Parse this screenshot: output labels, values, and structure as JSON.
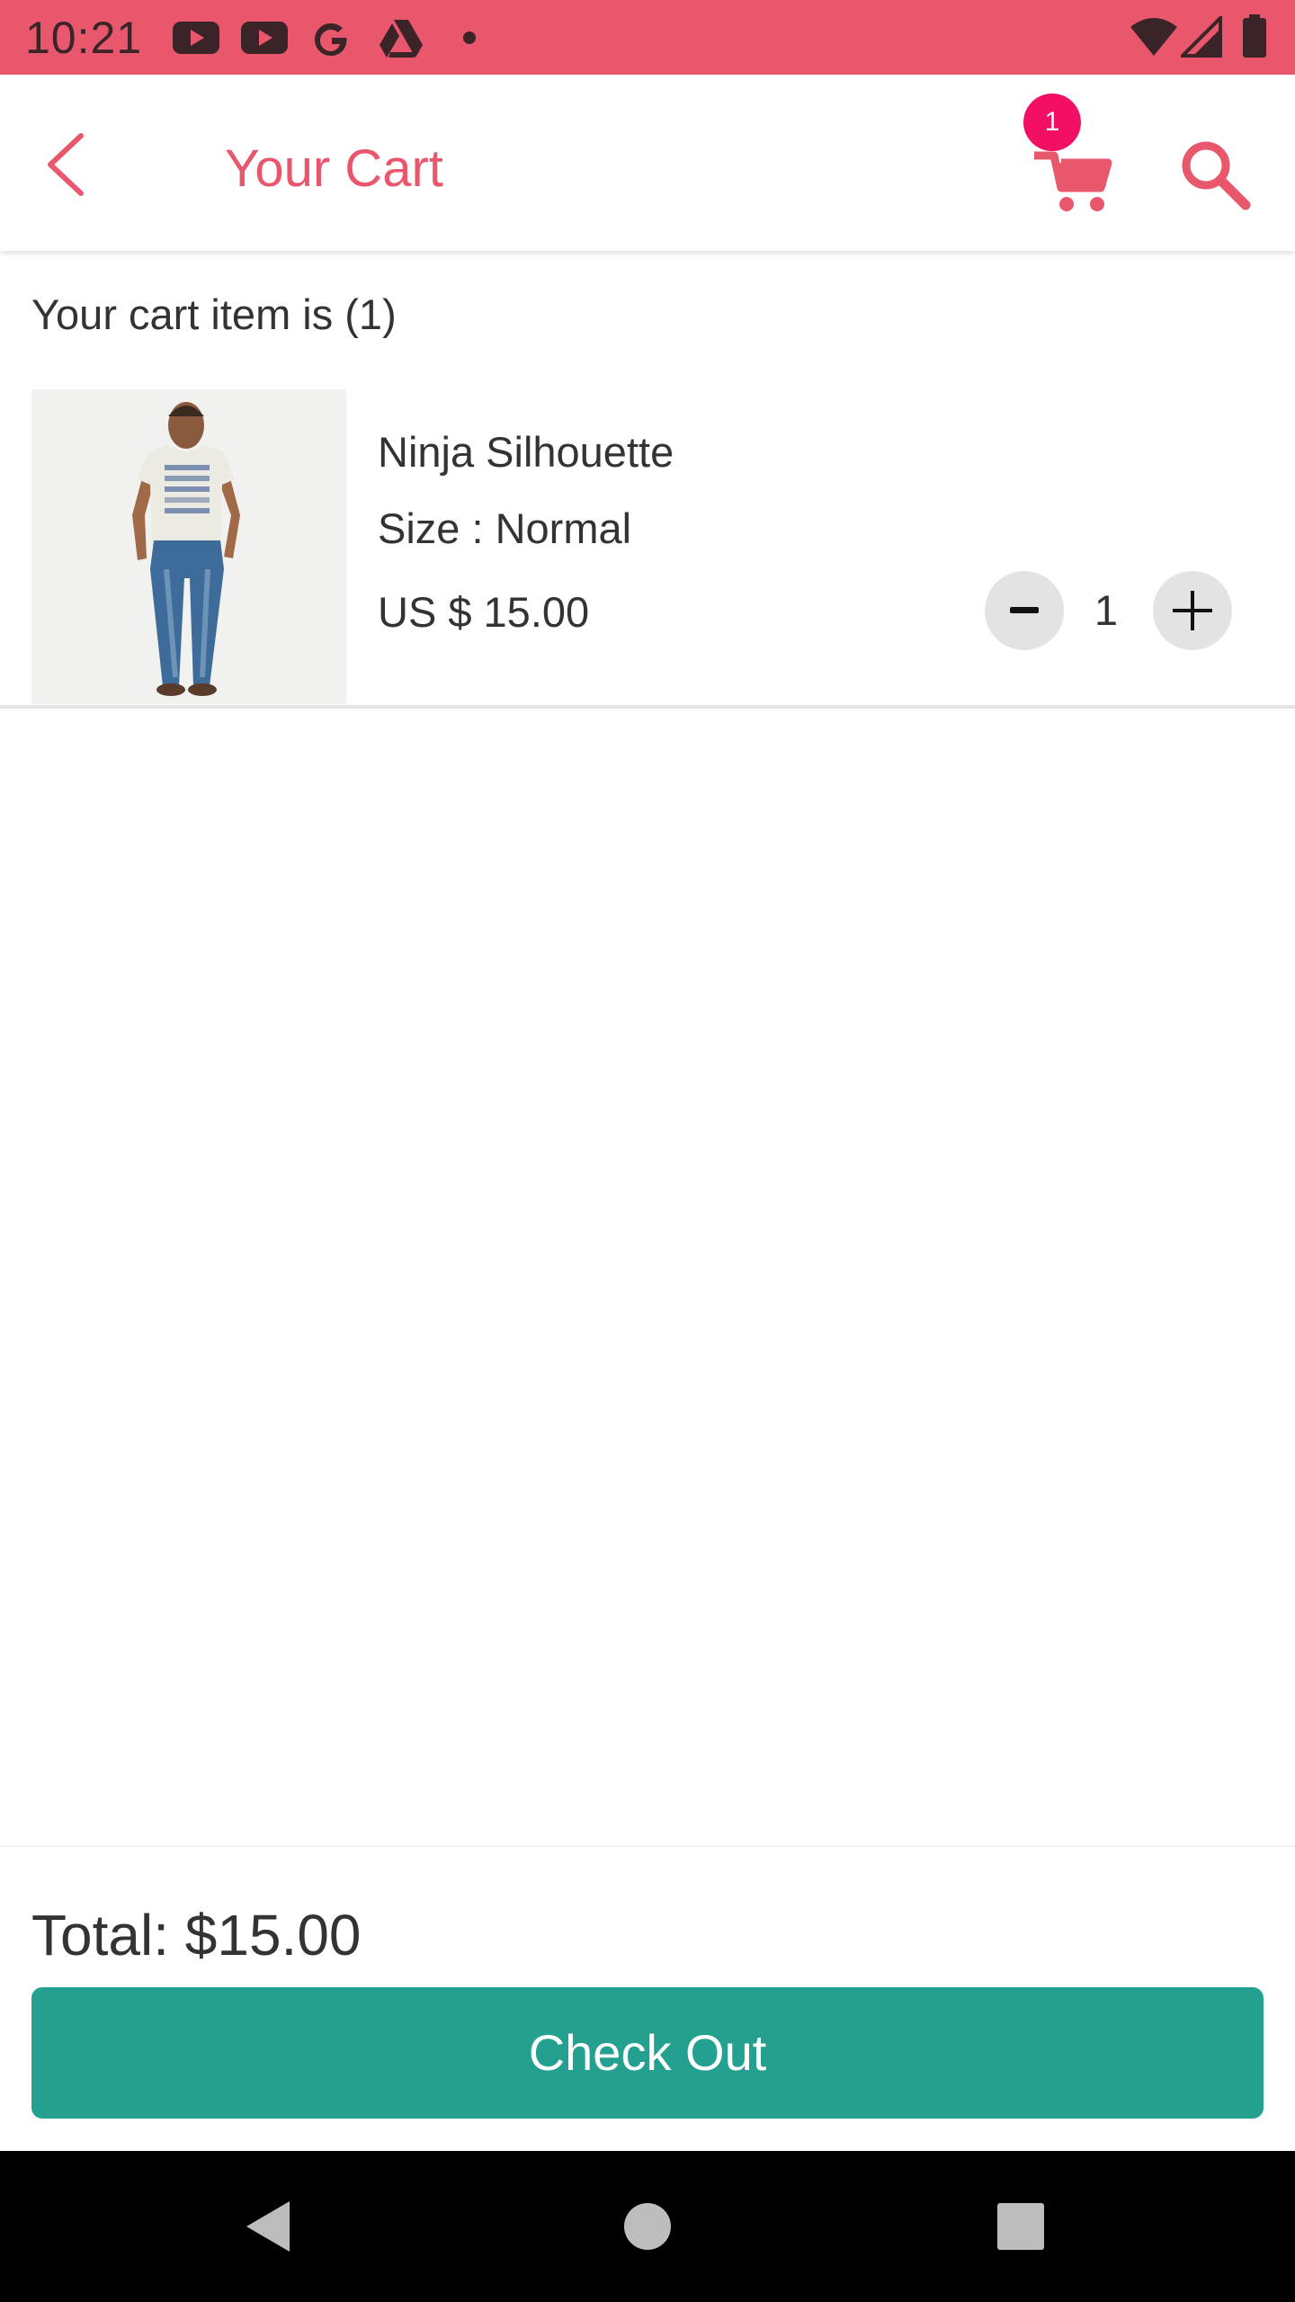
{
  "status_bar": {
    "time": "10:21",
    "color": "#e9576d",
    "left_icons": [
      "youtube-icon",
      "youtube-icon",
      "google-icon",
      "drive-icon",
      "dot-icon"
    ],
    "right_icons": [
      "wifi-icon",
      "signal-icon",
      "battery-icon"
    ]
  },
  "app_bar": {
    "title": "Your Cart",
    "accent_color": "#e9576d",
    "cart_badge_count": "1",
    "badge_color": "#f20f64"
  },
  "cart": {
    "count_text": "Your cart item is (1)",
    "items": [
      {
        "name": "Ninja Silhouette",
        "size": "Size : Normal",
        "price": "US $ 15.00",
        "quantity": "1",
        "image": "product-photo"
      }
    ]
  },
  "footer": {
    "total": "Total: $15.00",
    "checkout_label": "Check Out",
    "checkout_color": "#23a08f"
  },
  "nav_bar": {
    "buttons": [
      "back-triangle-icon",
      "home-circle-icon",
      "recents-square-icon"
    ]
  }
}
